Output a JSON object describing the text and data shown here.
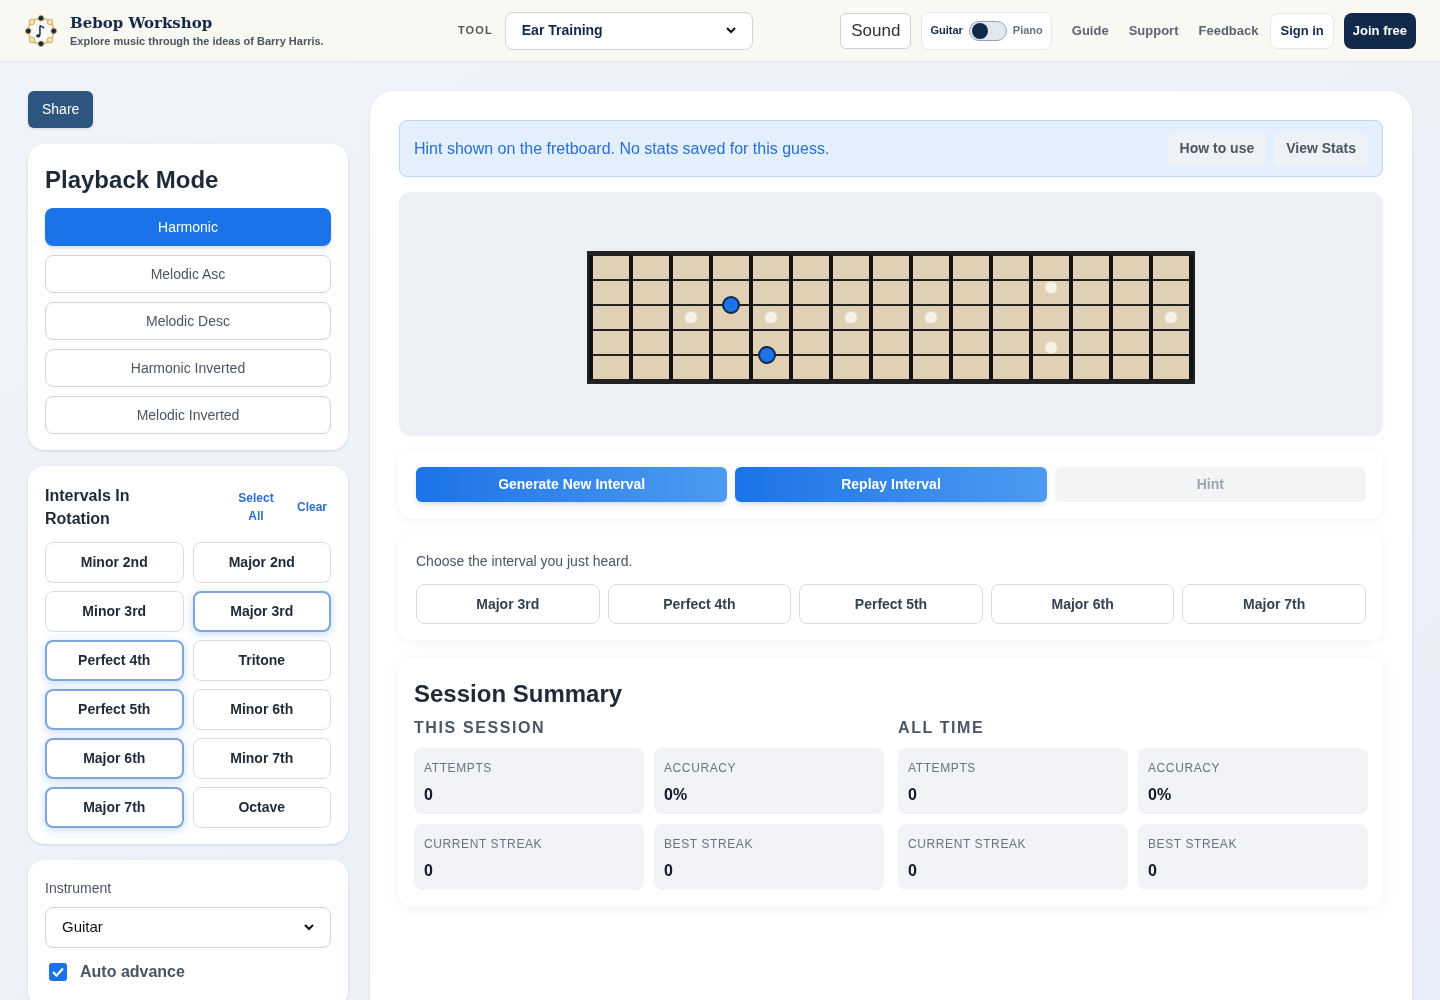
{
  "header": {
    "title": "Bebop Workshop",
    "subtitle": "Explore music through the ideas of Barry Harris.",
    "tool_label": "TOOL",
    "tool_select": "Ear Training",
    "sound_button": "Sound",
    "instrument_toggle": {
      "left": "Guitar",
      "right": "Piano",
      "on": false
    },
    "nav": [
      "Guide",
      "Support",
      "Feedback"
    ],
    "sign_in": "Sign in",
    "join": "Join free"
  },
  "share": "Share",
  "playback": {
    "title": "Playback Mode",
    "modes": [
      {
        "label": "Harmonic",
        "selected": true
      },
      {
        "label": "Melodic Asc",
        "selected": false
      },
      {
        "label": "Melodic Desc",
        "selected": false
      },
      {
        "label": "Harmonic Inverted",
        "selected": false
      },
      {
        "label": "Melodic Inverted",
        "selected": false
      }
    ]
  },
  "intervals": {
    "title": "Intervals In Rotation",
    "select_all": "Select All",
    "clear": "Clear",
    "items": [
      {
        "label": "Minor 2nd",
        "selected": false
      },
      {
        "label": "Major 2nd",
        "selected": false
      },
      {
        "label": "Minor 3rd",
        "selected": false
      },
      {
        "label": "Major 3rd",
        "selected": true
      },
      {
        "label": "Perfect 4th",
        "selected": true
      },
      {
        "label": "Tritone",
        "selected": false
      },
      {
        "label": "Perfect 5th",
        "selected": true
      },
      {
        "label": "Minor 6th",
        "selected": false
      },
      {
        "label": "Major 6th",
        "selected": true
      },
      {
        "label": "Minor 7th",
        "selected": false
      },
      {
        "label": "Major 7th",
        "selected": true
      },
      {
        "label": "Octave",
        "selected": false
      }
    ]
  },
  "settings": {
    "instrument_label": "Instrument",
    "instrument_value": "Guitar",
    "auto_advance": {
      "label": "Auto advance",
      "checked": true
    }
  },
  "banner": {
    "text": "Hint shown on the fretboard. No stats saved for this guess.",
    "buttons": [
      "How to use",
      "View Stats"
    ]
  },
  "actions": [
    {
      "label": "Generate New Interval",
      "disabled": false
    },
    {
      "label": "Replay Interval",
      "disabled": false
    },
    {
      "label": "Hint",
      "disabled": true
    }
  ],
  "prompt": "Choose the interval you just heard.",
  "answers": [
    "Major 3rd",
    "Perfect 4th",
    "Perfect 5th",
    "Major 6th",
    "Major 7th"
  ],
  "summary": {
    "title": "Session Summary",
    "groups": [
      {
        "title": "THIS SESSION",
        "stats": [
          {
            "label": "ATTEMPTS",
            "value": "0"
          },
          {
            "label": "ACCURACY",
            "value": "0%"
          },
          {
            "label": "CURRENT STREAK",
            "value": "0"
          },
          {
            "label": "BEST STREAK",
            "value": "0"
          }
        ]
      },
      {
        "title": "ALL TIME",
        "stats": [
          {
            "label": "ATTEMPTS",
            "value": "0"
          },
          {
            "label": "ACCURACY",
            "value": "0%"
          },
          {
            "label": "CURRENT STREAK",
            "value": "0"
          },
          {
            "label": "BEST STREAK",
            "value": "0"
          }
        ]
      }
    ]
  }
}
